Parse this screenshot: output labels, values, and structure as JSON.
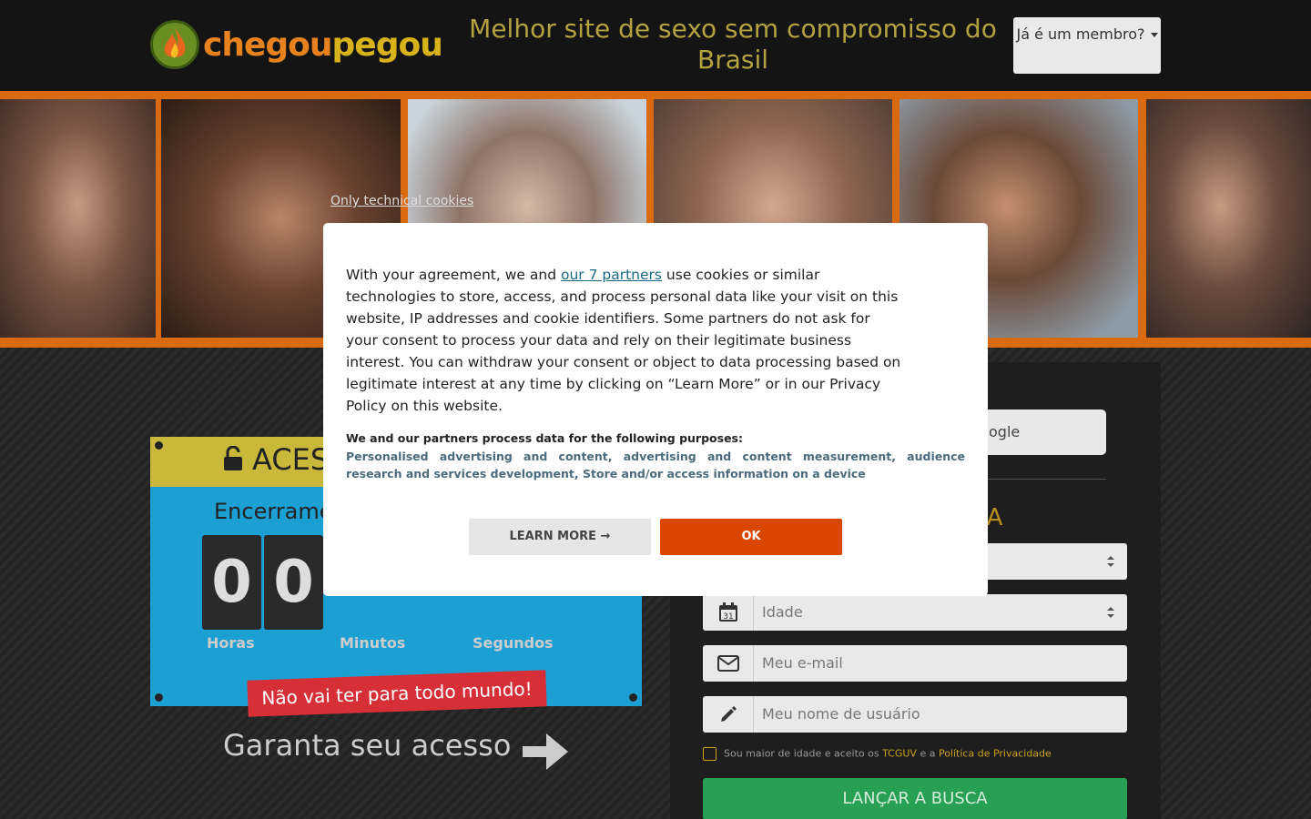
{
  "header": {
    "logo_part1": "chegou",
    "logo_part2": "pegou",
    "tagline": "Melhor site de sexo sem compromisso do Brasil",
    "member_button": "Já é um membro?"
  },
  "countdown": {
    "title": "ACES",
    "subtitle": "Encerrame",
    "digits": [
      "0",
      "0"
    ],
    "labels": {
      "hours": "Horas",
      "minutes": "Minutos",
      "seconds": "Segundos"
    },
    "banner": "Não vai ter para todo mundo!",
    "cta": "Garanta seu acesso"
  },
  "form": {
    "google_button": "ogle",
    "title": "DA",
    "age_placeholder": "Idade",
    "email_placeholder": "Meu e-mail",
    "username_placeholder": "Meu nome de usuário",
    "consent_prefix": "Sou maior de idade e aceito os",
    "consent_terms": "TCGUV",
    "consent_and": "e a",
    "consent_privacy": "Política de Privacidade",
    "submit": "LANÇAR A BUSCA"
  },
  "cookie": {
    "only_technical": "Only technical cookies",
    "text_before_link": "With your agreement, we and",
    "partners_link": "our 7 partners",
    "text_after_link": "use cookies or similar technologies to store, access, and process personal data like your visit on this website, IP addresses and cookie identifiers. Some partners do not ask for your consent to process your data and rely on their legitimate business interest. You can withdraw your consent or object to data processing based on legitimate interest at any time by clicking on “Learn More” or in our Privacy Policy on this website.",
    "purposes_title": "We and our partners process data for the following purposes:",
    "purposes": "Personalised advertising and content, advertising and content measurement, audience research and services development, Store and/or access information on a device",
    "learn_more": "LEARN MORE →",
    "ok": "OK"
  },
  "colors": {
    "orange_strip": "#d96a0f",
    "countdown_blue": "#1c9fd3",
    "ok_button": "#d94600",
    "submit_green": "#27a055"
  }
}
